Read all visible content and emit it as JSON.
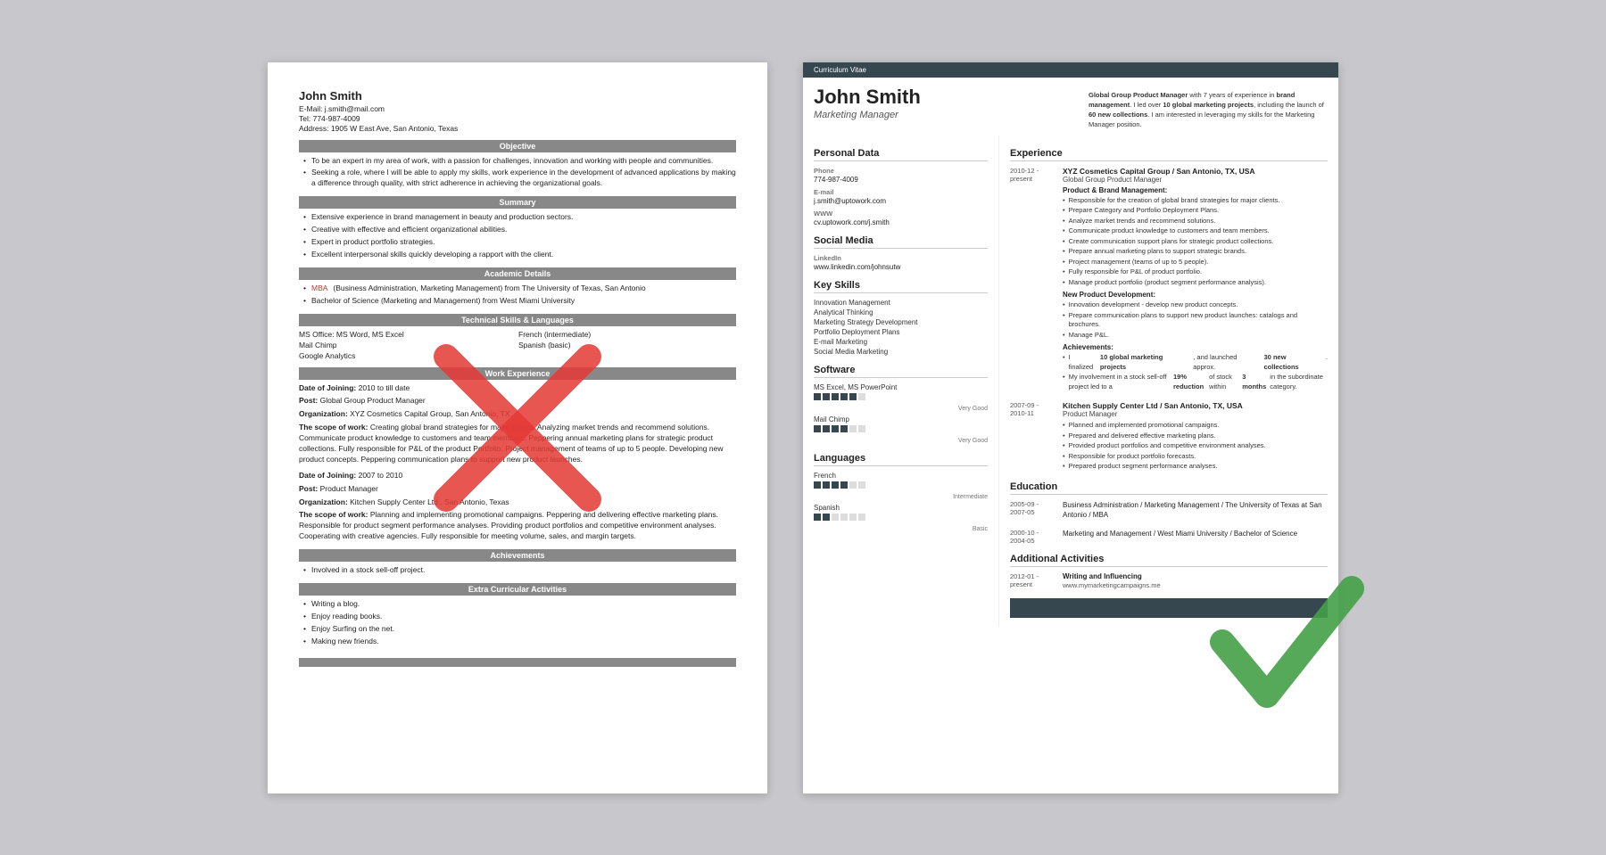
{
  "left_resume": {
    "name": "John Smith",
    "email": "E-Mail: j.smith@mail.com",
    "tel": "Tel: 774-987-4009",
    "address": "Address: 1905 W East Ave, San Antonio, Texas",
    "sections": {
      "objective": {
        "header": "Objective",
        "bullets": [
          "To be an expert in my area of work, with a passion for challenges, innovation and working with people and communities.",
          "Seeking a role, where I will be able to apply my skills, work experience in the development of advanced applications by making a difference through quality, with strict adherence in achieving the organizational goals."
        ]
      },
      "summary": {
        "header": "Summary",
        "bullets": [
          "Extensive experience in brand management in beauty and production sectors.",
          "Creative with effective and efficient organizational abilities.",
          "Expert in product portfolio strategies.",
          "Excellent interpersonal skills quickly developing a rapport with the client."
        ]
      },
      "academic": {
        "header": "Academic Details",
        "bullets": [
          "MBA (Business Administration, Marketing Management) from The University of Texas, San Antonio",
          "Bachelor of Science (Marketing and Management) from West Miami University"
        ]
      },
      "technical": {
        "header": "Technical Skills & Languages",
        "skills": [
          "MS Office: MS Word, MS Excel",
          "Mail Chimp",
          "Google Analytics",
          "French (intermediate)",
          "Spanish (basic)"
        ]
      },
      "work": {
        "header": "Work Experience",
        "entries": [
          {
            "date": "Date of Joining: 2010 to till date",
            "post": "Post: Global Group Product Manager",
            "org": "Organization: XYZ Cosmetics Capital Group, San Antonio, TX",
            "scope": "The scope of work: Creating global brand strategies for major clients. Analyzing market trends and recommend solutions. Communicate product knowledge to customers and team members. Peppering annual marketing plans for strategic product collections. Fully responsible for P&L of the product Portfolio. Project management of teams of up to 5 people. Developing new product concepts. Peppering communication plans to support new product launches."
          },
          {
            "date": "Date of Joining: 2007 to 2010",
            "post": "Post: Product Manager",
            "org": "Organization: Kitchen Supply Center Ltd., San Antonio, Texas",
            "scope": "The scope of work: Planning and implementing promotional campaigns. Peppering and delivering effective marketing plans. Responsible for product segment performance analyses. Providing product portfolios and competitive environment analyses. Cooperating with creative agencies. Fully responsible for meeting volume, sales, and margin targets."
          }
        ]
      },
      "achievements": {
        "header": "Achievements",
        "bullets": [
          "Involved in a stock sell-off project."
        ]
      },
      "extra": {
        "header": "Extra Curricular Activities",
        "bullets": [
          "Writing a blog.",
          "Enjoy reading books.",
          "Enjoy Surfing on the net.",
          "Making new friends."
        ]
      }
    }
  },
  "right_resume": {
    "cv_label": "Curriculum Vitae",
    "name": "John Smith",
    "title": "Marketing Manager",
    "profile_text": "Global Group Product Manager with 7 years of experience in brand management. I led over 10 global marketing projects, including the launch of 60 new collections. I am interested in leveraging my skills for the Marketing Manager position.",
    "personal_data": {
      "section_title": "Personal Data",
      "phone_label": "Phone",
      "phone": "774-987-4009",
      "email_label": "E-mail",
      "email": "j.smith@uptowork.com",
      "www_label": "WWW",
      "www": "cv.uptowork.com/j.smith"
    },
    "social_media": {
      "section_title": "Social Media",
      "linkedin_label": "LinkedIn",
      "linkedin": "www.linkedin.com/johnsutw"
    },
    "key_skills": {
      "section_title": "Key Skills",
      "skills": [
        "Innovation Management",
        "Analytical Thinking",
        "Marketing Strategy Development",
        "Portfolio Deployment Plans",
        "E-mail Marketing",
        "Social Media Marketing"
      ]
    },
    "software": {
      "section_title": "Software",
      "items": [
        {
          "name": "MS Excel, MS PowerPoint",
          "level": 5,
          "max": 6,
          "label": "Very Good"
        },
        {
          "name": "Mail Chimp",
          "level": 4,
          "max": 6,
          "label": "Very Good"
        }
      ]
    },
    "languages": {
      "section_title": "Languages",
      "items": [
        {
          "name": "French",
          "level": 4,
          "max": 6,
          "label": "Intermediate"
        },
        {
          "name": "Spanish",
          "level": 2,
          "max": 6,
          "label": "Basic"
        }
      ]
    },
    "experience": {
      "section_title": "Experience",
      "entries": [
        {
          "date": "2010-12 -\npresent",
          "company": "XYZ Cosmetics Capital Group / San Antonio, TX, USA",
          "role": "Global Group Product Manager",
          "subsections": [
            {
              "label": "Product & Brand Management:",
              "bullets": [
                "Responsible for the creation of global brand strategies for major clients.",
                "Prepare Category and Portfolio Deployment Plans.",
                "Analyze market trends and recommend solutions.",
                "Communicate product knowledge to customers and team members.",
                "Create communication support plans for strategic product collections.",
                "Prepare annual marketing plans to support strategic brands.",
                "Project management (teams of up to 5 people).",
                "Fully responsible for P&L of product portfolio.",
                "Manage product portfolio (product segment performance analysis)."
              ]
            },
            {
              "label": "New Product Development:",
              "bullets": [
                "Innovation development - develop new product concepts.",
                "Prepare communication plans to support new product launches: catalogs and brochures.",
                "Manage P&L."
              ]
            },
            {
              "label": "Achievements:",
              "bullets": [
                "I finalized 10 global marketing projects, and launched approx. 30 new collections.",
                "My involvement in a stock sell-off project led to a 19% reduction of stock within 3 months in the subordinate category."
              ]
            }
          ]
        },
        {
          "date": "2007-09 -\n2010-11",
          "company": "Kitchen Supply Center Ltd / San Antonio, TX, USA",
          "role": "Product Manager",
          "subsections": [
            {
              "label": "",
              "bullets": [
                "Planned and implemented promotional campaigns.",
                "Prepared and delivered effective marketing plans.",
                "Provided product portfolios and competitive environment analyses.",
                "Responsible for product portfolio forecasts.",
                "Prepared product segment performance analyses."
              ]
            }
          ]
        }
      ]
    },
    "education": {
      "section_title": "Education",
      "entries": [
        {
          "date": "2005-09 -\n2007-05",
          "school": "Business Administration / Marketing Management / The University of Texas at San Antonio / MBA"
        },
        {
          "date": "2000-10 -\n2004-05",
          "school": "Marketing and Management / West Miami University / Bachelor of Science"
        }
      ]
    },
    "additional": {
      "section_title": "Additional Activities",
      "entries": [
        {
          "date": "2012-01 -\npresent",
          "title": "Writing and Influencing",
          "value": "www.mymarketingcampaigns.me"
        }
      ]
    }
  }
}
